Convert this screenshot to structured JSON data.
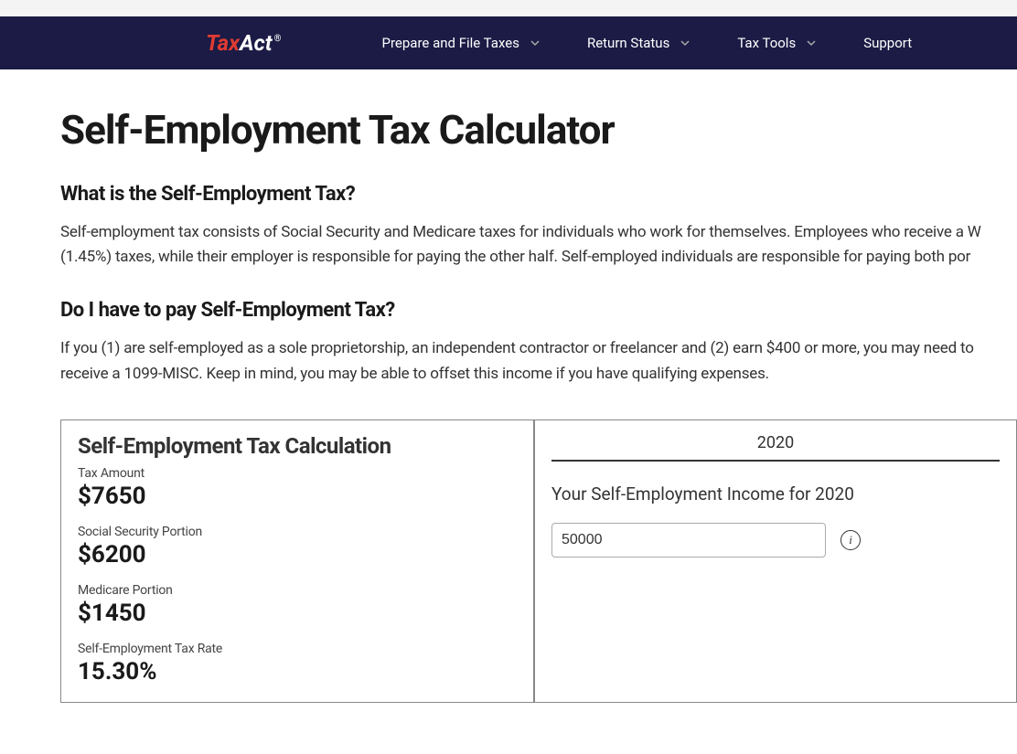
{
  "nav": {
    "logo_tax": "Tax",
    "logo_act": "Act",
    "items": [
      {
        "label": "Prepare and File Taxes",
        "has_dropdown": true
      },
      {
        "label": "Return Status",
        "has_dropdown": true
      },
      {
        "label": "Tax Tools",
        "has_dropdown": true
      },
      {
        "label": "Support",
        "has_dropdown": false
      }
    ]
  },
  "page": {
    "title": "Self-Employment Tax Calculator",
    "section1_heading": "What is the Self-Employment Tax?",
    "section1_text": "Self-employment tax consists of Social Security and Medicare taxes for individuals who work for themselves. Employees who receive a W (1.45%) taxes, while their employer is responsible for paying the other half. Self-employed individuals are responsible for paying both por",
    "section2_heading": "Do I have to pay Self-Employment Tax?",
    "section2_text": "If you (1) are self-employed as a sole proprietorship, an independent contractor or freelancer and (2) earn $400 or more, you may need to receive a 1099-MISC. Keep in mind, you may be able to offset this income if you have qualifying expenses."
  },
  "calculator": {
    "title": "Self-Employment Tax Calculation",
    "tax_amount_label": "Tax Amount",
    "tax_amount_value": "$7650",
    "ss_label": "Social Security Portion",
    "ss_value": "$6200",
    "medicare_label": "Medicare Portion",
    "medicare_value": "$1450",
    "rate_label": "Self-Employment Tax Rate",
    "rate_value": "15.30%",
    "year_tab": "2020",
    "input_label": "Your Self-Employment Income for 2020",
    "input_value": "50000"
  }
}
